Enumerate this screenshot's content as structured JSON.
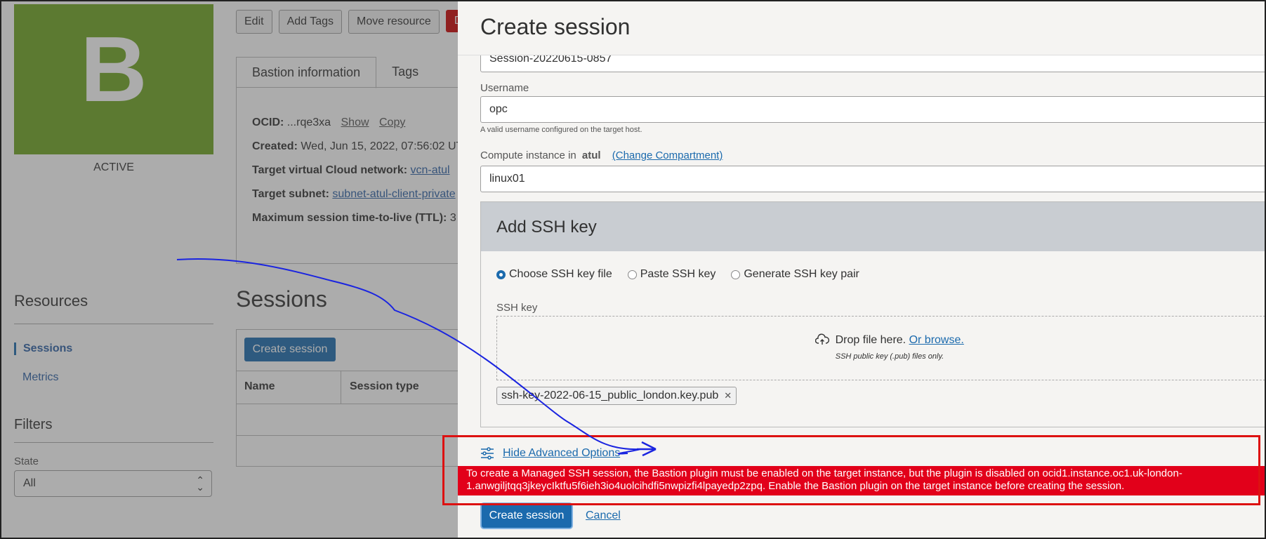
{
  "background": {
    "tile_letter": "B",
    "status": "ACTIVE",
    "actions": [
      "Edit",
      "Add Tags",
      "Move resource"
    ],
    "danger_button_partial": "D",
    "tabs": [
      "Bastion information",
      "Tags"
    ],
    "info": {
      "ocid_label": "OCID:",
      "ocid_value": "...rqe3xa",
      "show": "Show",
      "copy": "Copy",
      "created_label": "Created:",
      "created_value": "Wed, Jun 15, 2022, 07:56:02 UT",
      "vcn_label": "Target virtual Cloud network:",
      "vcn_value": "vcn-atul",
      "subnet_label": "Target subnet:",
      "subnet_value": "subnet-atul-client-private",
      "ttl_label": "Maximum session time-to-live (TTL):",
      "ttl_value": "3"
    },
    "resources_title": "Resources",
    "resources_items": [
      "Sessions",
      "Metrics"
    ],
    "filters_title": "Filters",
    "state_label": "State",
    "state_value": "All",
    "sessions_title": "Sessions",
    "sessions_create": "Create session",
    "columns": [
      "Name",
      "Session type"
    ]
  },
  "modal": {
    "title": "Create session",
    "session_name_value": "Session-20220615-0857",
    "username_label": "Username",
    "username_value": "opc",
    "username_hint": "A valid username configured on the target host.",
    "compute_label": "Compute instance in",
    "compute_compartment": "atul",
    "change_compartment": "(Change Compartment)",
    "compute_value": "linux01",
    "ssh_title": "Add SSH key",
    "ssh_options": [
      "Choose SSH key file",
      "Paste SSH key",
      "Generate SSH key pair"
    ],
    "ssh_selected": "Choose SSH key file",
    "ssh_key_label": "SSH key",
    "drop_text": "Drop file here.",
    "browse_text": "Or browse.",
    "drop_hint": "SSH public key (.pub) files only.",
    "key_file": "ssh-key-2022-06-15_public_london.key.pub",
    "advanced_link": "Hide Advanced Options",
    "error_line1": "To create a Managed SSH session, the Bastion plugin must be enabled on the target instance, but the plugin is disabled on ocid1.instance.oc1.uk-london-",
    "error_line2": "1.anwgiljtqq3jkeycIktfu5f6ieh3io4uolcihdfi5nwpizfi4lpayedp2zpq. Enable the Bastion plugin on the target instance before creating the session.",
    "create_button": "Create session",
    "cancel": "Cancel"
  },
  "colors": {
    "tile": "#6da51f",
    "primary": "#1b6aad",
    "error": "#e2001a",
    "annotation_box": "#dd1111",
    "annotation_arrow": "#1a24e0"
  }
}
